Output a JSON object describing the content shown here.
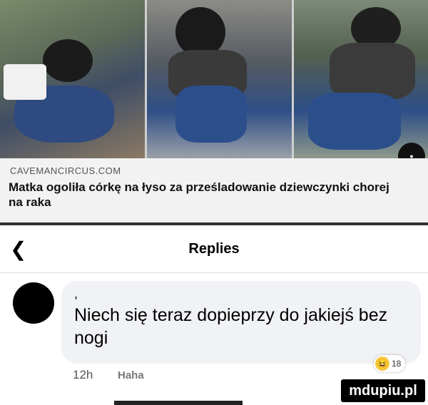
{
  "source": {
    "site": "CAVEMANCIRCUS.COM"
  },
  "caption": {
    "text": "Matka ogoliła córkę na łyso za prześladowanie dziewczynki chorej na raka"
  },
  "header": {
    "title": "Replies",
    "back_icon": "chevron-left-icon"
  },
  "comment": {
    "prefix": ",",
    "text": "Niech się teraz dopieprzy do jakiejś bez nogi",
    "time": "12h",
    "reaction_label": "Haha",
    "reaction_count": "18",
    "reaction_icon": "haha-emoji-icon"
  },
  "watermark": {
    "text": "mdupiu.pl"
  }
}
